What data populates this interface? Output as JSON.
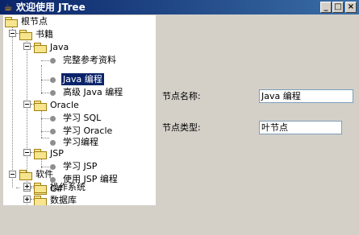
{
  "window": {
    "title": "欢迎使用 JTree",
    "minimize_glyph": "_",
    "maximize_glyph": "□",
    "close_glyph": "×"
  },
  "tree": {
    "root": "根节点",
    "books": "书籍",
    "java": "Java",
    "java_items": [
      "完整参考资料",
      "Java 编程",
      "高级 Java 编程"
    ],
    "oracle": "Oracle",
    "oracle_items": [
      "学习 SQL",
      "学习 Oracle",
      "学习编程"
    ],
    "jsp": "JSP",
    "jsp_items": [
      "学习 JSP",
      "使用 JSP 编程"
    ],
    "csharp": "C#",
    "software": "软件",
    "os": "操作系统",
    "db": "数据库",
    "selected": "Java 编程"
  },
  "details": {
    "name_label": "节点名称:",
    "name_value": "Java 编程",
    "type_label": "节点类型:",
    "type_value": "叶节点"
  }
}
